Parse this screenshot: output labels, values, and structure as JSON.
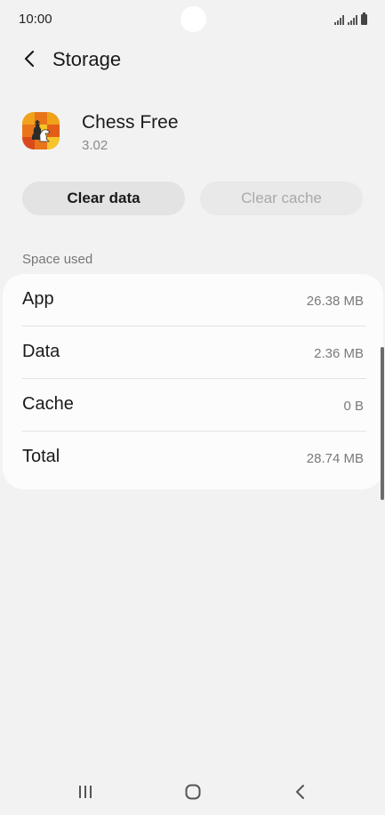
{
  "status_bar": {
    "time": "10:00"
  },
  "header": {
    "title": "Storage",
    "back_icon": "chevron-left-icon"
  },
  "app": {
    "name": "Chess Free",
    "version": "3.02",
    "icon": "chess-app-icon"
  },
  "actions": {
    "clear_data_label": "Clear data",
    "clear_cache_label": "Clear cache",
    "clear_cache_enabled": false
  },
  "space_used": {
    "label": "Space used",
    "rows": [
      {
        "label": "App",
        "value": "26.38 MB"
      },
      {
        "label": "Data",
        "value": "2.36 MB"
      },
      {
        "label": "Cache",
        "value": "0 B"
      },
      {
        "label": "Total",
        "value": "28.74 MB"
      }
    ]
  },
  "nav_bar": {
    "recents_icon": "recents-icon",
    "home_icon": "home-icon",
    "back_icon": "back-icon"
  },
  "colors": {
    "background": "#f2f2f2",
    "card": "#fcfcfc",
    "primary_button": "#e3e3e3",
    "disabled_text": "#a9a9a9",
    "secondary_text": "#7a7a7a"
  }
}
